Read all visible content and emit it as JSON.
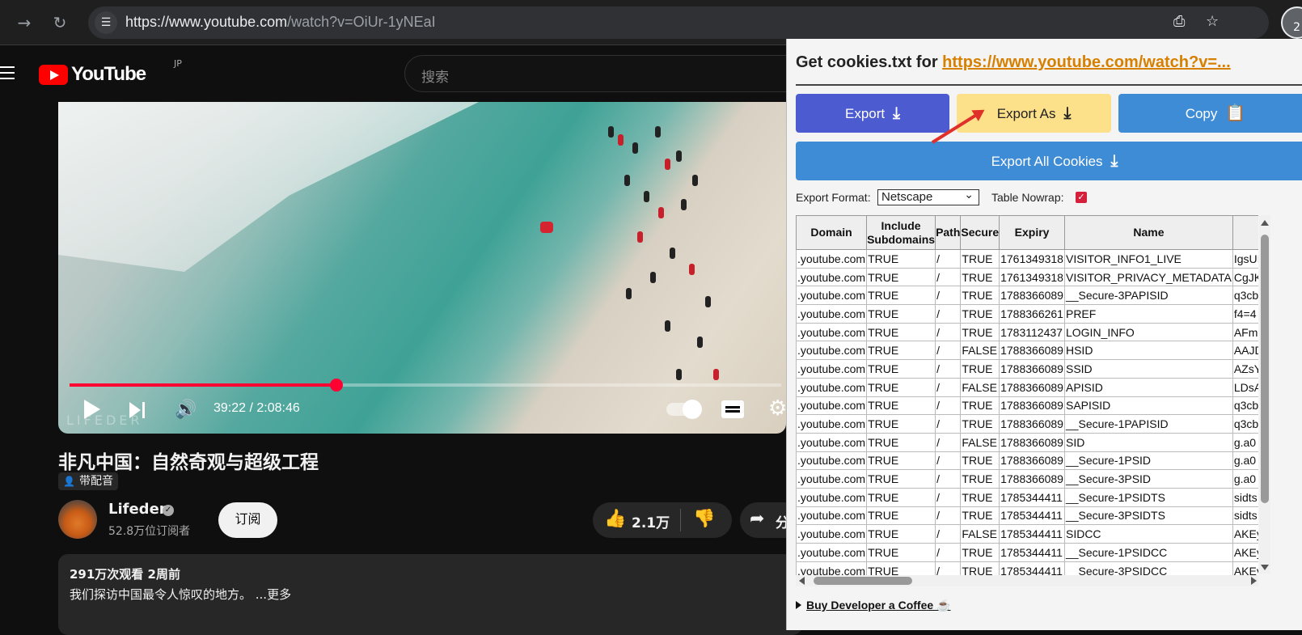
{
  "browser": {
    "url_host": "https://www.youtube.com",
    "url_path": "/watch?v=OiUr-1yNEaI",
    "profile_badge": "2"
  },
  "youtube": {
    "logo_text": "YouTube",
    "region": "JP",
    "search_placeholder": "搜索",
    "player": {
      "time": "39:22 / 2:08:46",
      "progress_fraction": 0.3
    },
    "watermark": "LIFEDER",
    "video_title": "非凡中国：自然奇观与超级工程",
    "dub_label": "带配音",
    "channel_name": "Lifeder",
    "subscribers": "52.8万位订阅者",
    "subscribe_label": "订阅",
    "like_count": "2.1万",
    "share_label": "分",
    "views_meta": "291万次观看  2周前",
    "description": "我们探访中国最令人惊叹的地方。 ...更多"
  },
  "popup": {
    "heading_prefix": "Get cookies.txt for ",
    "heading_link": "https://www.youtube.com/watch?v=...",
    "buttons": {
      "export": "Export",
      "export_as": "Export As",
      "copy": "Copy",
      "export_all": "Export All Cookies"
    },
    "export_format_label": "Export Format:",
    "export_format_value": "Netscape",
    "table_nowrap_label": "Table Nowrap:",
    "table_nowrap_checked": true,
    "columns": [
      "Domain",
      "Include Subdomains",
      "Path",
      "Secure",
      "Expiry",
      "Name",
      ""
    ],
    "rows": [
      [
        ".youtube.com",
        "TRUE",
        "/",
        "TRUE",
        "1761349318",
        "VISITOR_INFO1_LIVE",
        "IgsUI"
      ],
      [
        ".youtube.com",
        "TRUE",
        "/",
        "TRUE",
        "1761349318",
        "VISITOR_PRIVACY_METADATA",
        "CgJK"
      ],
      [
        ".youtube.com",
        "TRUE",
        "/",
        "TRUE",
        "1788366089",
        "__Secure-3PAPISID",
        "q3cb"
      ],
      [
        ".youtube.com",
        "TRUE",
        "/",
        "TRUE",
        "1788366261",
        "PREF",
        "f4=4"
      ],
      [
        ".youtube.com",
        "TRUE",
        "/",
        "TRUE",
        "1783112437",
        "LOGIN_INFO",
        "AFm"
      ],
      [
        ".youtube.com",
        "TRUE",
        "/",
        "FALSE",
        "1788366089",
        "HSID",
        "AAJD"
      ],
      [
        ".youtube.com",
        "TRUE",
        "/",
        "TRUE",
        "1788366089",
        "SSID",
        "AZsY"
      ],
      [
        ".youtube.com",
        "TRUE",
        "/",
        "FALSE",
        "1788366089",
        "APISID",
        "LDsA"
      ],
      [
        ".youtube.com",
        "TRUE",
        "/",
        "TRUE",
        "1788366089",
        "SAPISID",
        "q3cb"
      ],
      [
        ".youtube.com",
        "TRUE",
        "/",
        "TRUE",
        "1788366089",
        "__Secure-1PAPISID",
        "q3cb"
      ],
      [
        ".youtube.com",
        "TRUE",
        "/",
        "FALSE",
        "1788366089",
        "SID",
        "g.a0"
      ],
      [
        ".youtube.com",
        "TRUE",
        "/",
        "TRUE",
        "1788366089",
        "__Secure-1PSID",
        "g.a0"
      ],
      [
        ".youtube.com",
        "TRUE",
        "/",
        "TRUE",
        "1788366089",
        "__Secure-3PSID",
        "g.a0"
      ],
      [
        ".youtube.com",
        "TRUE",
        "/",
        "TRUE",
        "1785344411",
        "__Secure-1PSIDTS",
        "sidts"
      ],
      [
        ".youtube.com",
        "TRUE",
        "/",
        "TRUE",
        "1785344411",
        "__Secure-3PSIDTS",
        "sidts"
      ],
      [
        ".youtube.com",
        "TRUE",
        "/",
        "FALSE",
        "1785344411",
        "SIDCC",
        "AKEy"
      ],
      [
        ".youtube.com",
        "TRUE",
        "/",
        "TRUE",
        "1785344411",
        "__Secure-1PSIDCC",
        "AKEy"
      ],
      [
        ".youtube.com",
        "TRUE",
        "/",
        "TRUE",
        "1785344411",
        "__Secure-3PSIDCC",
        "AKEy"
      ]
    ],
    "coffee_link": "Buy Developer a Coffee ☕"
  },
  "colors": {
    "yt_red": "#ff0000",
    "progress_red": "#ff0033",
    "export_blue": "#4d5bd0",
    "export_as_yellow": "#fde08a",
    "copy_blue": "#3f8cd6",
    "link_orange": "#d78000",
    "checkbox_red": "#d4203a"
  },
  "icons": {
    "back": "arrow-right-icon",
    "reload": "reload-icon",
    "site_settings": "tune-icon",
    "install": "install-icon",
    "bookmark": "star-icon",
    "download": "download-icon",
    "clipboard": "clipboard-icon"
  }
}
